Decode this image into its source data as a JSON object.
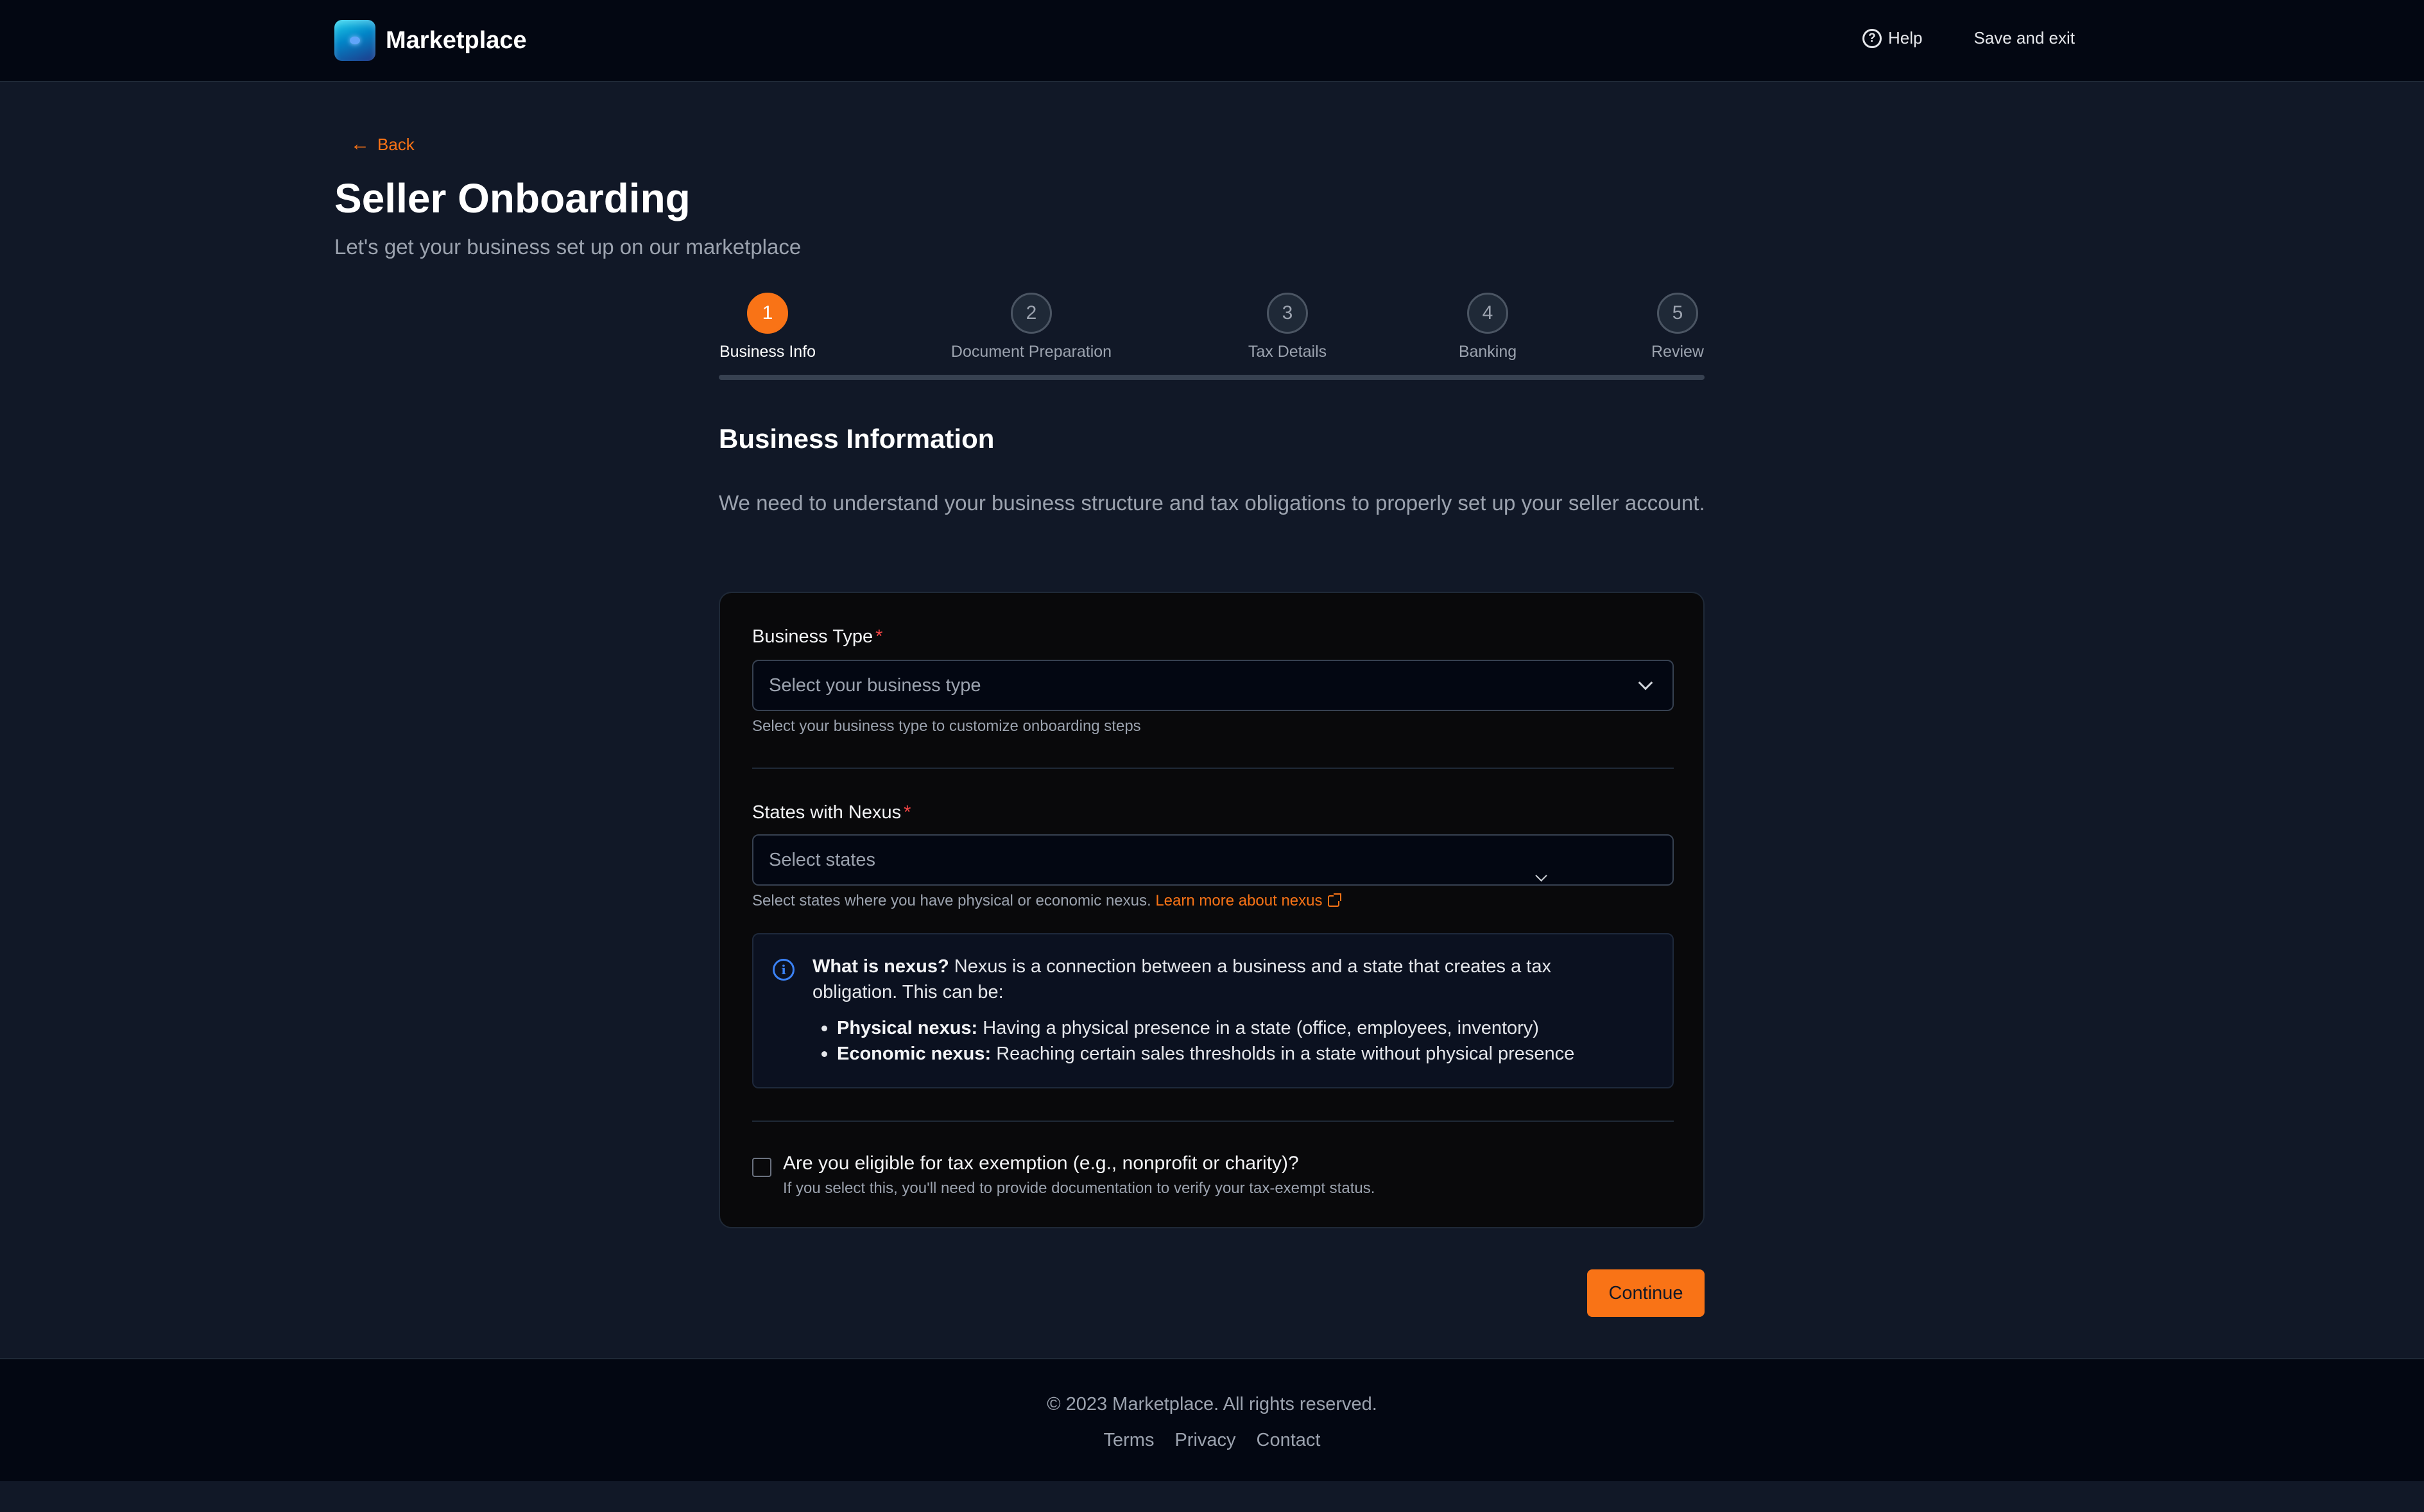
{
  "header": {
    "brand": "Marketplace",
    "help_label": "Help",
    "save_exit_label": "Save and exit"
  },
  "nav": {
    "back_label": "Back"
  },
  "page": {
    "title": "Seller Onboarding",
    "subtitle": "Let's get your business set up on our marketplace"
  },
  "stepper": {
    "active_step": 1,
    "steps": [
      {
        "number": "1",
        "label": "Business Info"
      },
      {
        "number": "2",
        "label": "Document Preparation"
      },
      {
        "number": "3",
        "label": "Tax Details"
      },
      {
        "number": "4",
        "label": "Banking"
      },
      {
        "number": "5",
        "label": "Review"
      }
    ]
  },
  "section": {
    "title": "Business Information",
    "description": "We need to understand your business structure and tax obligations to properly set up your seller account."
  },
  "form": {
    "business_type": {
      "label": "Business Type",
      "required_mark": "*",
      "placeholder": "Select your business type",
      "hint": "Select your business type to customize onboarding steps"
    },
    "nexus_states": {
      "label": "States with Nexus",
      "required_mark": "*",
      "placeholder": "Select states",
      "hint": "Select states where you have physical or economic nexus.",
      "hint_link": "Learn more about nexus"
    },
    "nexus_info": {
      "lead_bold": "What is nexus?",
      "lead_text": "Nexus is a connection between a business and a state that creates a tax obligation. This can be:",
      "items": [
        {
          "term": "Physical nexus:",
          "text": "Having a physical presence in a state (office, employees, inventory)"
        },
        {
          "term": "Economic nexus:",
          "text": "Reaching certain sales thresholds in a state without physical presence"
        }
      ]
    },
    "tax_exempt": {
      "checked": false,
      "label": "Are you eligible for tax exemption (e.g., nonprofit or charity)?",
      "hint": "If you select this, you'll need to provide documentation to verify your tax-exempt status."
    },
    "continue_label": "Continue"
  },
  "footer": {
    "copyright": "© 2023 Marketplace. All rights reserved.",
    "links": [
      "Terms",
      "Privacy",
      "Contact"
    ]
  },
  "colors": {
    "accent": "#f97316",
    "background": "#111827",
    "header_bg": "#030712",
    "card_bg": "#09090b",
    "info_icon": "#3b82f6",
    "required": "#ef4444"
  },
  "icons": {
    "help": "help-circle-icon",
    "back": "arrow-left-icon",
    "select": "chevron-down-icon",
    "external": "external-link-icon",
    "info": "info-circle-icon"
  }
}
